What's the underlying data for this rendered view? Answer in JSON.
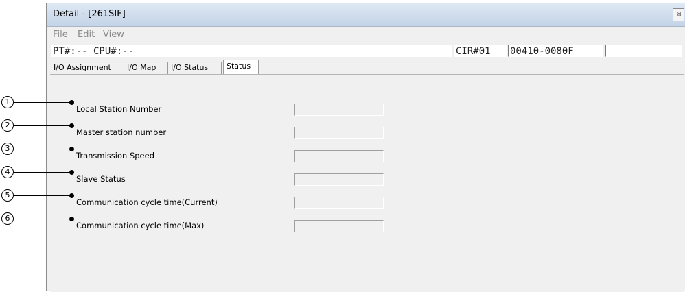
{
  "window": {
    "title": "Detail - [261SIF]",
    "close_glyph": "⊠"
  },
  "menu": [
    "File",
    "Edit",
    "View"
  ],
  "status_bar": {
    "left": "PT#:-- CPU#:--",
    "circuit": "CIR#01",
    "address": "00410-0080F",
    "extra": ""
  },
  "tabs": [
    {
      "label": "I/O Assignment",
      "active": false
    },
    {
      "label": "I/O Map",
      "active": false
    },
    {
      "label": "I/O Status",
      "active": false
    },
    {
      "label": "Status",
      "active": true
    }
  ],
  "status_fields": [
    {
      "number": "1",
      "label": "Local Station Number",
      "value": ""
    },
    {
      "number": "2",
      "label": "Master station number",
      "value": ""
    },
    {
      "number": "3",
      "label": "Transmission Speed",
      "value": ""
    },
    {
      "number": "4",
      "label": "Slave Status",
      "value": ""
    },
    {
      "number": "5",
      "label": "Communication cycle time(Current)",
      "value": ""
    },
    {
      "number": "6",
      "label": "Communication cycle time(Max)",
      "value": ""
    }
  ]
}
